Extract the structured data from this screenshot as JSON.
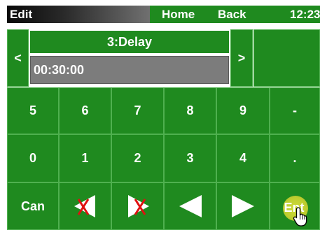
{
  "header": {
    "title": "Edit",
    "home_label": "Home",
    "back_label": "Back",
    "time": "12:23"
  },
  "editor": {
    "prev_label": "<",
    "next_label": ">",
    "param_name": "3:Delay",
    "value": "00:30:00"
  },
  "keypad": {
    "row1": [
      "5",
      "6",
      "7",
      "8",
      "9",
      "-"
    ],
    "row2": [
      "0",
      "1",
      "2",
      "3",
      "4",
      "."
    ],
    "cancel_label": "Can",
    "enter_label": "Ent"
  },
  "icons": {
    "delete_left": "delete-left-icon",
    "delete_right": "delete-right-icon",
    "cursor_left": "cursor-left-arrow-icon",
    "cursor_right": "cursor-right-arrow-icon",
    "pointer": "hand-pointer-icon"
  },
  "colors": {
    "panel_green": "#1f8a1f",
    "tile_border": "#4fb04f",
    "field_gray": "#7c7c7c",
    "delete_x_red": "#e01010",
    "touch_highlight": "#c6d130"
  }
}
